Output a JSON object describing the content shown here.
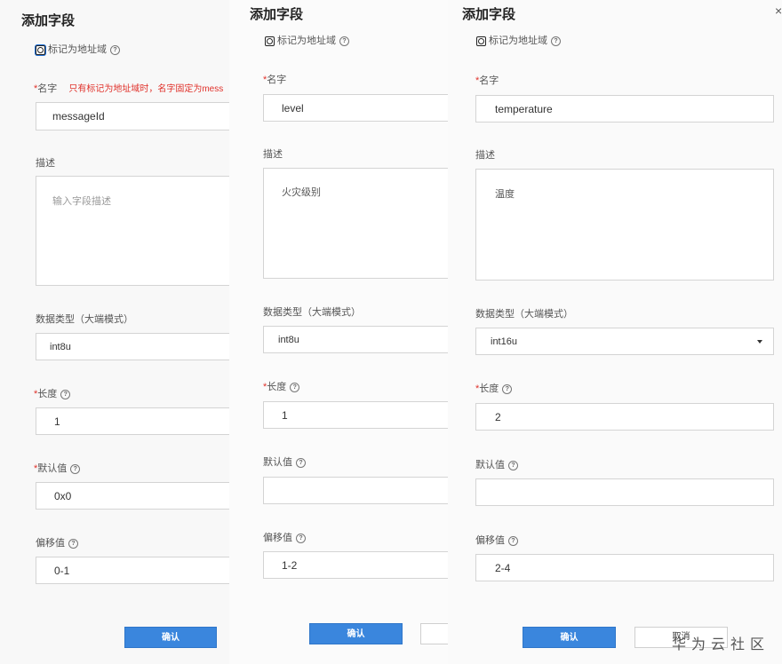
{
  "panel1": {
    "title": "添加字段",
    "address_checkbox_label": "标记为地址域",
    "name_label": "名字",
    "name_error": "只有标记为地址域时，名字固定为mess",
    "name_value": "messageId",
    "desc_label": "描述",
    "desc_placeholder": "输入字段描述",
    "type_label": "数据类型（大端模式）",
    "type_value": "int8u",
    "length_label": "长度",
    "length_value": "1",
    "default_label": "默认值",
    "default_value": "0x0",
    "offset_label": "偏移值",
    "offset_value": "0-1",
    "confirm_label": "确认"
  },
  "panel2": {
    "title": "添加字段",
    "address_checkbox_label": "标记为地址域",
    "name_label": "名字",
    "name_value": "level",
    "desc_label": "描述",
    "desc_value": "火灾级别",
    "type_label": "数据类型（大端模式）",
    "type_value": "int8u",
    "length_label": "长度",
    "length_value": "1",
    "default_label": "默认值",
    "default_value": "",
    "offset_label": "偏移值",
    "offset_value": "1-2",
    "confirm_label": "确认"
  },
  "panel3": {
    "title": "添加字段",
    "address_checkbox_label": "标记为地址域",
    "name_label": "名字",
    "name_value": "temperature",
    "desc_label": "描述",
    "desc_value": "温度",
    "type_label": "数据类型（大端模式）",
    "type_value": "int16u",
    "length_label": "长度",
    "length_value": "2",
    "default_label": "默认值",
    "default_value": "",
    "offset_label": "偏移值",
    "offset_value": "2-4",
    "confirm_label": "确认",
    "cancel_label": "取消"
  },
  "icons": {
    "help": "question-circle-icon",
    "close": "close-icon",
    "dropdown": "caret-down-icon"
  },
  "colors": {
    "primary": "#3a86dd",
    "required": "#e0322b"
  },
  "watermark": "华为云社区"
}
